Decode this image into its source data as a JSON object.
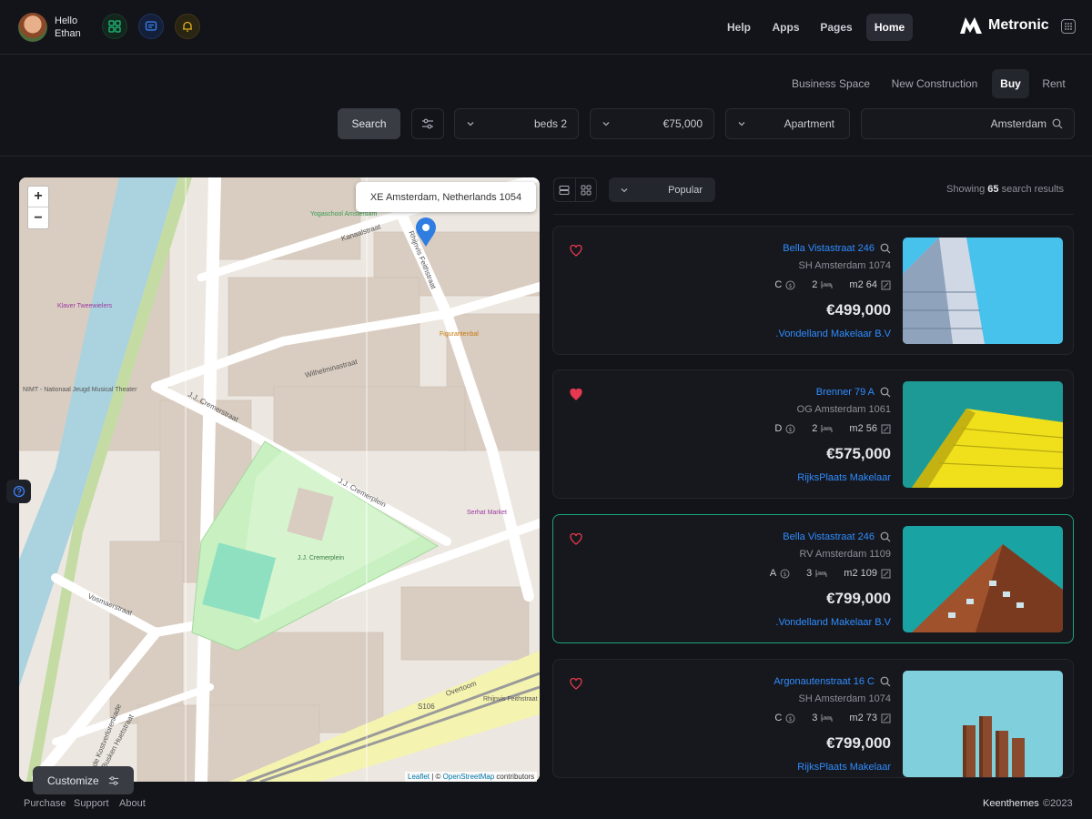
{
  "user": {
    "greeting": "Hello",
    "name": "Ethan"
  },
  "header": {
    "nav": [
      "Help",
      "Apps",
      "Pages",
      "Home"
    ],
    "active_nav": "Home",
    "logo_text": "Metronic"
  },
  "subnav": {
    "tabs": [
      "Business Space",
      "New Construction",
      "Buy",
      "Rent"
    ],
    "active": "Buy"
  },
  "filters": {
    "search_button": "Search",
    "beds": "beds 2",
    "price": "€75,000",
    "type": "Apartment",
    "location": "Amsterdam"
  },
  "map": {
    "tooltip": "XE Amsterdam, Netherlands 1054",
    "zoom_in": "+",
    "zoom_out": "−",
    "attribution_leaflet": "Leaflet",
    "attribution_sep": " | © ",
    "attribution_osm": "OpenStreetMap",
    "attribution_contrib": " contributors",
    "labels": [
      "Derde Kostverlorenkade",
      "Kanaalstraat",
      "Rhijnvis Feithstraat",
      "Wilhelminastraat",
      "J.J. Cremerstraat",
      "J.J. Cremerplein",
      "Vosmaerstraat",
      "Overtoom",
      "Busken Huetstraat",
      "S106",
      "Yogaschool Amsterdam",
      "Figurantenbal",
      "Klaver Tweewielers",
      "NIMT - Nationaal Jeugd Musical Theater",
      "Serhat Market",
      "Rhijnvis Feithstraat",
      "J.J. Cremerplein"
    ]
  },
  "customize": "Customize",
  "list": {
    "sort": "Popular",
    "showing_prefix": "Showing",
    "showing_count": "65",
    "showing_suffix": "search results"
  },
  "listings": [
    {
      "title": "Bella Vistastraat 246",
      "address": "SH Amsterdam 1074",
      "energy": "C",
      "rooms": "2",
      "area": "m2 64",
      "price": "€499,000",
      "agent": ".Vondelland Makelaar B.V",
      "favorite": false,
      "selected": false
    },
    {
      "title": "Brenner 79 A",
      "address": "OG Amsterdam 1061",
      "energy": "D",
      "rooms": "2",
      "area": "m2 56",
      "price": "€575,000",
      "agent": "RijksPlaats Makelaar",
      "favorite": true,
      "selected": false
    },
    {
      "title": "Bella Vistastraat 246",
      "address": "RV Amsterdam 1109",
      "energy": "A",
      "rooms": "3",
      "area": "m2 109",
      "price": "€799,000",
      "agent": ".Vondelland Makelaar B.V",
      "favorite": false,
      "selected": true
    },
    {
      "title": "Argonautenstraat 16 C",
      "address": "SH Amsterdam 1074",
      "energy": "C",
      "rooms": "3",
      "area": "m2 73",
      "price": "€799,000",
      "agent": "RijksPlaats Makelaar",
      "favorite": false,
      "selected": false
    }
  ],
  "footer": {
    "links": [
      "Purchase",
      "Support",
      "About"
    ],
    "brand": "Keenthemes",
    "copyright": "©2023"
  },
  "colors": {
    "accent": "#2f8cff",
    "selected_border": "#1aa57a",
    "heart": "#e53950",
    "background": "#131419"
  }
}
